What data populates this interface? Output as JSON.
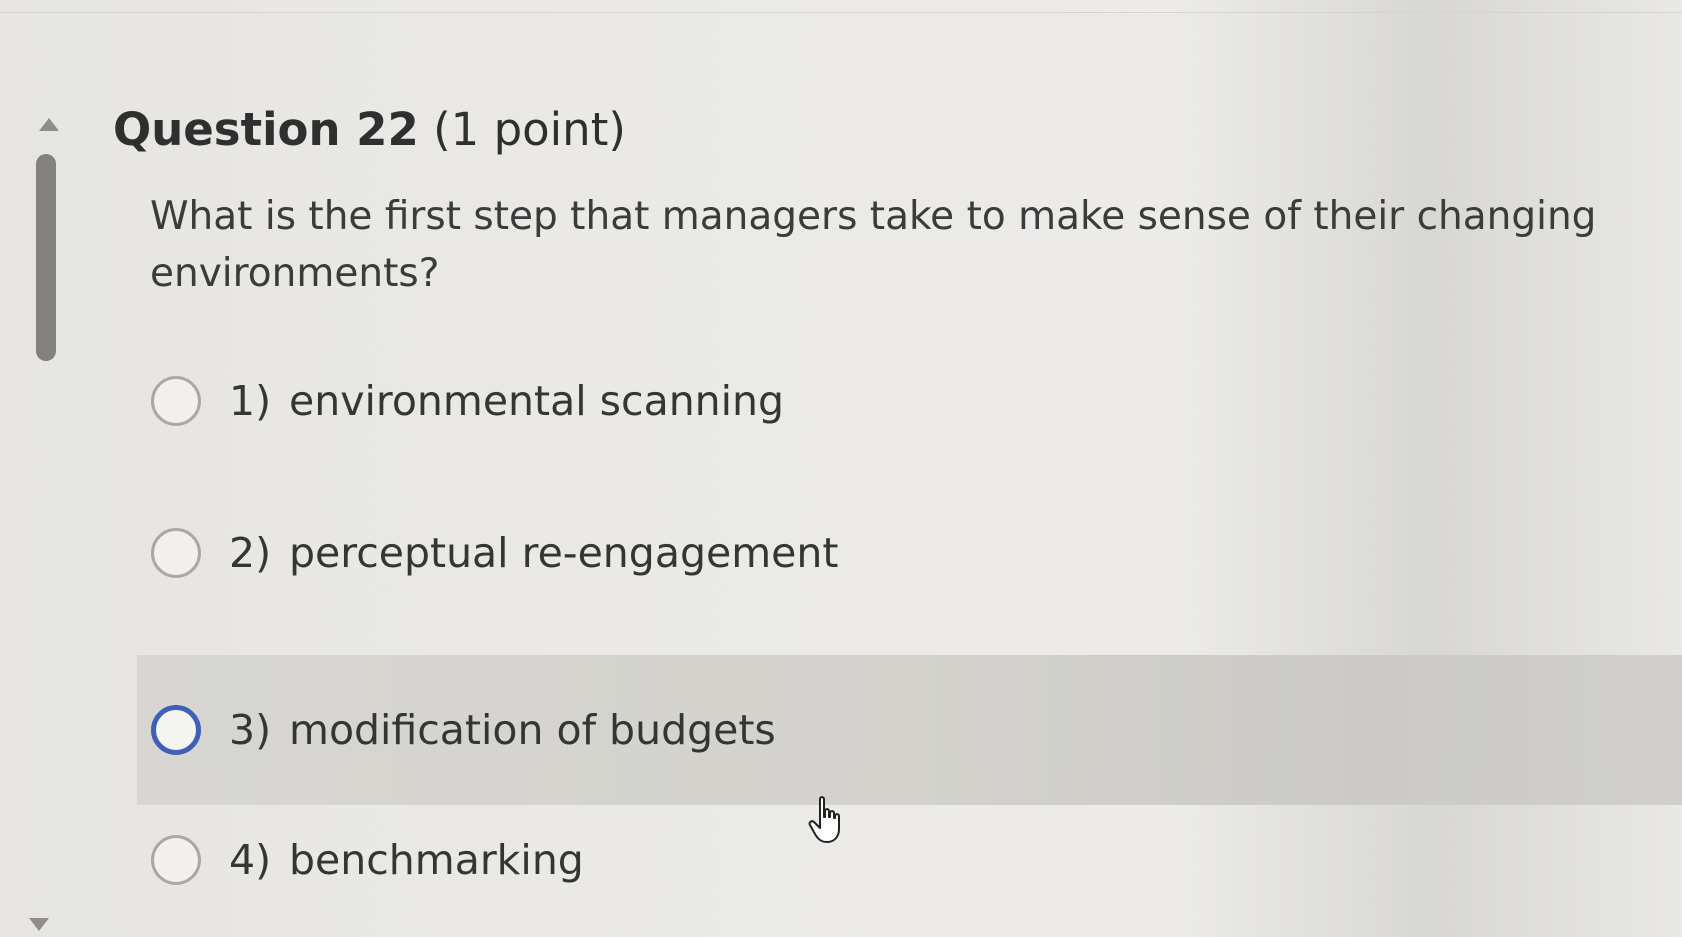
{
  "question": {
    "label": "Question 22",
    "points": "(1 point)",
    "text": "What is the first step that managers take to make sense of their changing environments?"
  },
  "options": [
    {
      "number": "1)",
      "text": "environmental scanning",
      "selected": false
    },
    {
      "number": "2)",
      "text": "perceptual re-engagement",
      "selected": false
    },
    {
      "number": "3)",
      "text": "modification of budgets",
      "selected": false
    },
    {
      "number": "4)",
      "text": "benchmarking",
      "selected": false
    }
  ],
  "hover": {
    "option": "3)"
  },
  "colors": {
    "radio_hover_border": "#3f60b7",
    "hover_background": "#d3d2cd",
    "scroll_thumb": "#828180"
  },
  "icons": {
    "scroll_up": "triangle-up",
    "scroll_down": "triangle-down",
    "cursor": "hand-pointer"
  }
}
